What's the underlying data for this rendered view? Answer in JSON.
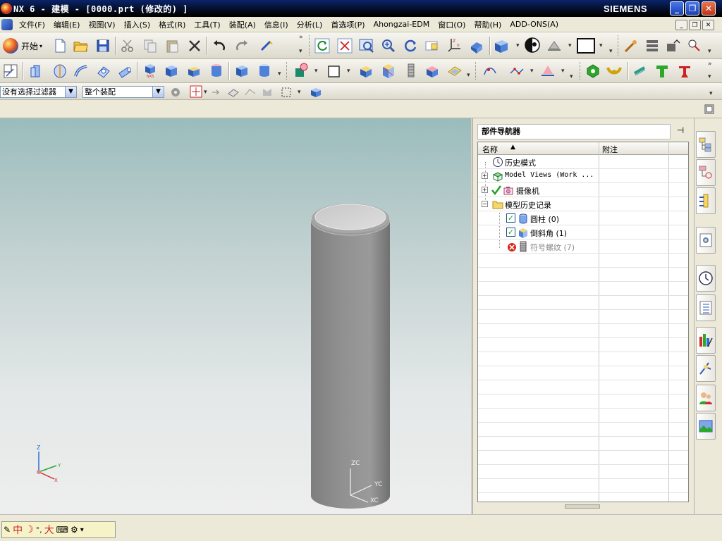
{
  "window": {
    "title": "NX 6 - 建模 - [0000.prt (修改的) ]",
    "brand": "SIEMENS",
    "minimize_glyph": "_",
    "maximize_glyph": "❐",
    "close_glyph": "✕"
  },
  "menubar": {
    "items": [
      {
        "label": "文件(F)"
      },
      {
        "label": "编辑(E)"
      },
      {
        "label": "视图(V)"
      },
      {
        "label": "插入(S)"
      },
      {
        "label": "格式(R)"
      },
      {
        "label": "工具(T)"
      },
      {
        "label": "装配(A)"
      },
      {
        "label": "信息(I)"
      },
      {
        "label": "分析(L)"
      },
      {
        "label": "首选项(P)"
      },
      {
        "label": "Ahongzai-EDM"
      },
      {
        "label": "窗口(O)"
      },
      {
        "label": "帮助(H)"
      },
      {
        "label": "ADD-ONS(A)"
      }
    ]
  },
  "toolbar1": {
    "start_label": "开始",
    "icons": [
      "new-file-icon",
      "open-folder-icon",
      "save-icon",
      "cut-icon",
      "copy-icon",
      "paste-icon",
      "delete-icon",
      "undo-icon",
      "redo-icon",
      "repeat-command-icon",
      "refresh-icon",
      "fit-icon",
      "zoom-window-icon",
      "zoom-icon",
      "rotate-icon",
      "pan-icon",
      "wcs-icon",
      "perspective-icon",
      "shaded-icon",
      "render-style-icon",
      "view-section-icon",
      "background-icon",
      "assembly-icon",
      "layer-settings-icon",
      "move-layer-icon",
      "analysis-icon"
    ]
  },
  "filter": {
    "selection_filter": "没有选择过滤器",
    "assembly_scope": "整个装配"
  },
  "viewport": {
    "triad_z": "Z",
    "triad_y": "Y",
    "triad_x": "X",
    "wcs_z": "ZC",
    "wcs_y": "YC",
    "wcs_x": "XC"
  },
  "colors": {
    "title_gradient_start": "#0a246a",
    "viewport_top": "#9bbcbc",
    "viewport_bottom": "#eeeeee",
    "cylinder_body": "#8c8c8c",
    "cylinder_top": "#d0d0d0",
    "error_red": "#d9261c",
    "check_green": "#21a121"
  },
  "part_navigator": {
    "title": "部件导航器",
    "pin_glyph": "⊣",
    "col_name": "名称",
    "col_note": "附注",
    "sort_glyph": "▲",
    "rows": [
      {
        "label": "历史模式",
        "indent": 0,
        "icon": "clock-icon",
        "expander": "",
        "checked": null,
        "dimmed": false
      },
      {
        "label": "Model Views (Work ...",
        "indent": 0,
        "icon": "model-views-icon",
        "expander": "+",
        "checked": null,
        "dimmed": false
      },
      {
        "label": "摄像机",
        "indent": 0,
        "icon": "camera-icon",
        "expander": "+",
        "checked": true,
        "dimmed": false
      },
      {
        "label": "模型历史记录",
        "indent": 0,
        "icon": "folder-icon",
        "expander": "−",
        "checked": null,
        "dimmed": false
      },
      {
        "label": "圆柱 (0)",
        "indent": 1,
        "icon": "cylinder-feature-icon",
        "expander": "",
        "checked": true,
        "dimmed": false
      },
      {
        "label": "倒斜角 (1)",
        "indent": 1,
        "icon": "chamfer-feature-icon",
        "expander": "",
        "checked": true,
        "dimmed": false
      },
      {
        "label": "符号螺纹 (7)",
        "indent": 1,
        "icon": "thread-feature-icon",
        "expander": "",
        "checked": false,
        "dimmed": true
      }
    ]
  },
  "resource_bar": {
    "tabs": [
      "assembly-navigator-icon",
      "constraint-navigator-icon",
      "part-navigator-icon",
      "reuse-library-icon",
      "history-icon",
      "system-materials-icon",
      "role-icon",
      "process-icon",
      "user-roles-icon",
      "palette-icon"
    ]
  },
  "ime": {
    "chars": [
      "中",
      "☽",
      "°,",
      "大"
    ]
  }
}
